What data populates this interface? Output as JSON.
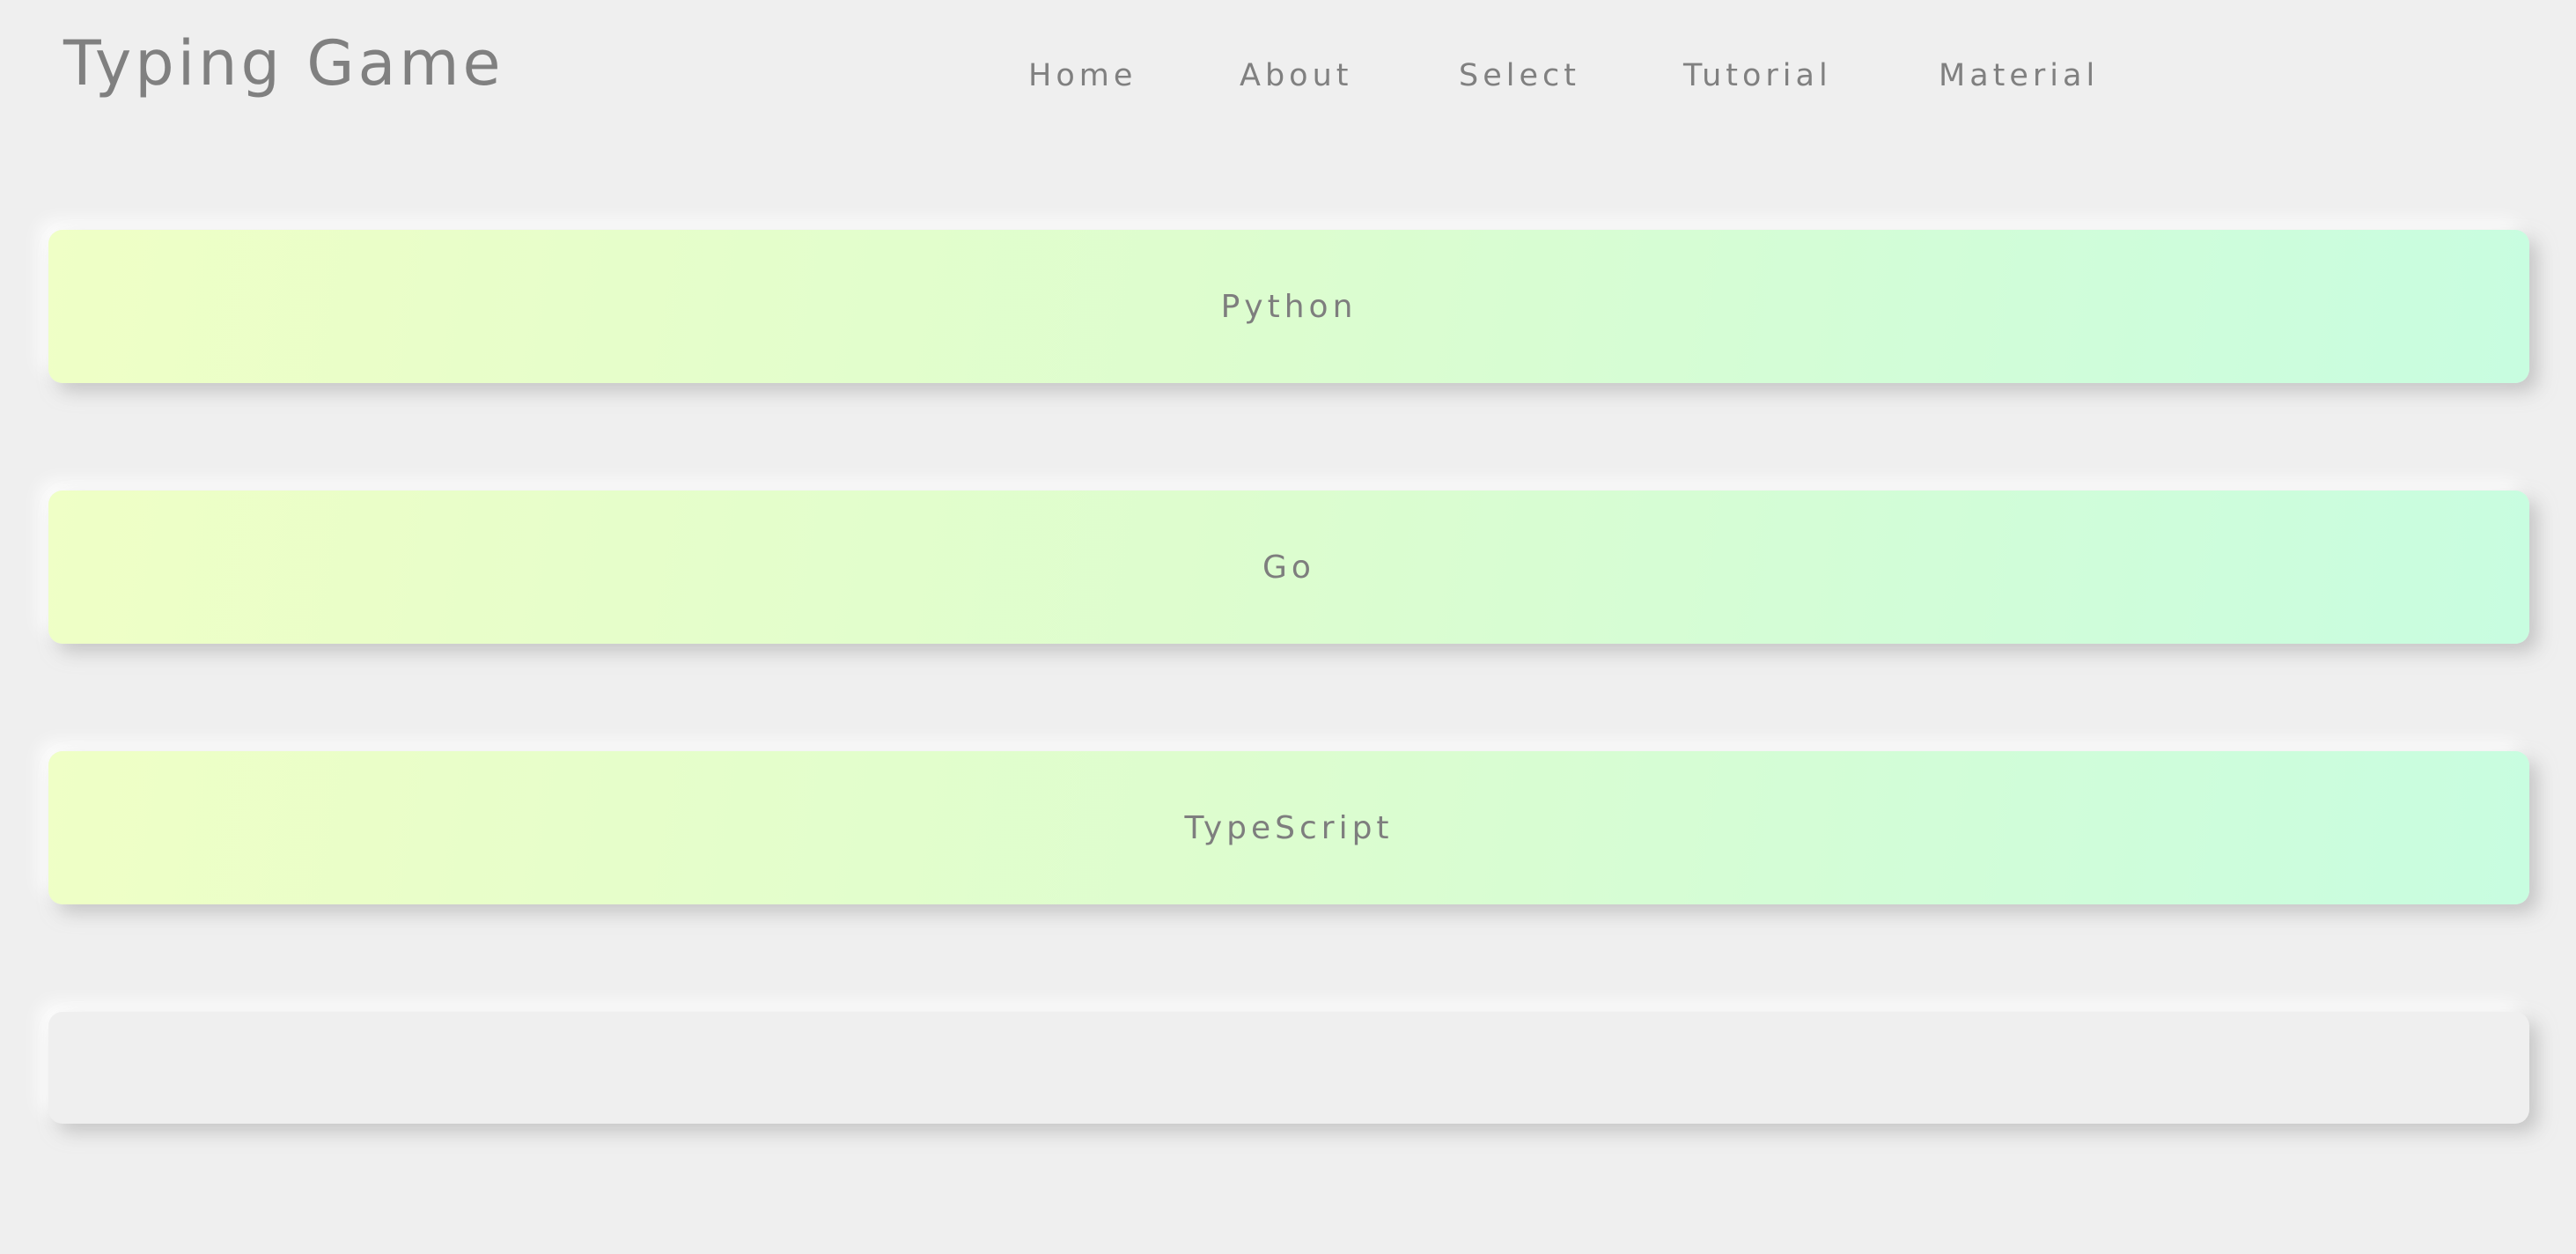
{
  "header": {
    "title": "Typing Game",
    "nav": [
      {
        "label": "Home"
      },
      {
        "label": "About"
      },
      {
        "label": "Select"
      },
      {
        "label": "Tutorial"
      },
      {
        "label": "Material"
      }
    ]
  },
  "main": {
    "languages": [
      {
        "label": "Python"
      },
      {
        "label": "Go"
      },
      {
        "label": "TypeScript"
      },
      {
        "label": ""
      }
    ]
  },
  "colors": {
    "background": "#efefef",
    "text": "#7e7e7e",
    "card_gradient_start": "#efffc6",
    "card_gradient_end": "#c8fde0"
  }
}
